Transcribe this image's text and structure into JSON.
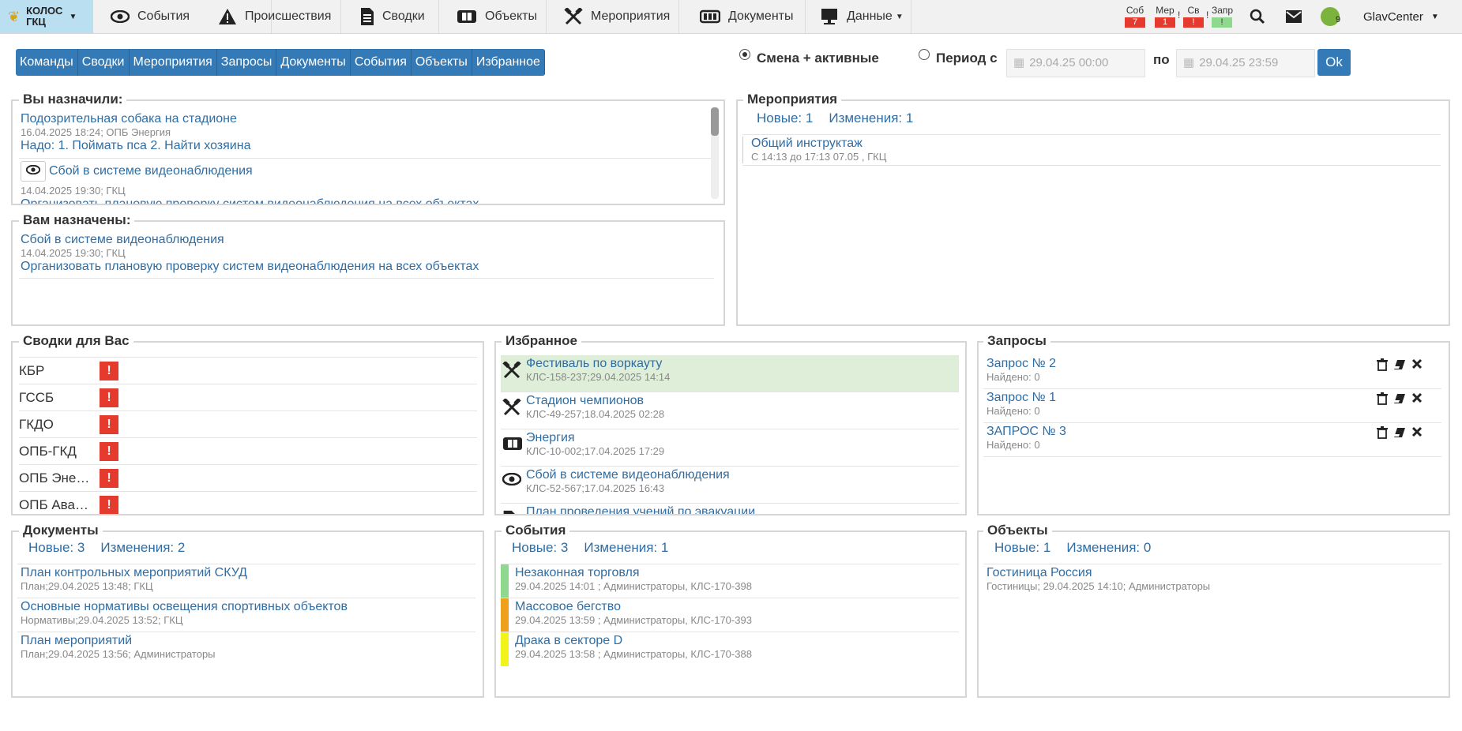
{
  "brand": {
    "title_line1": "КОЛОС",
    "title_line2": "ГКЦ"
  },
  "nav": [
    {
      "label": "События",
      "icon": "eye-icon"
    },
    {
      "label": "Происшествия",
      "icon": "warning-icon"
    },
    {
      "label": "Сводки",
      "icon": "document-icon"
    },
    {
      "label": "Объекты",
      "icon": "stadium-icon"
    },
    {
      "label": "Мероприятия",
      "icon": "crossed-hammers-icon"
    },
    {
      "label": "Документы",
      "icon": "documents-icon"
    },
    {
      "label": "Данные",
      "icon": "monitor-icon"
    }
  ],
  "indicators": [
    {
      "label": "Соб",
      "value": "7",
      "color": "#e53b2f"
    },
    {
      "label": "Мер",
      "value": "1",
      "color": "#e53b2f"
    },
    {
      "label": "Св",
      "value": "!",
      "color": "#e53b2f"
    },
    {
      "label": "Запр",
      "value": "!",
      "color": "#8fd98f"
    }
  ],
  "user": {
    "name": "GlavCenter",
    "badge": "9"
  },
  "tabs": [
    "Команды",
    "Сводки",
    "Мероприятия",
    "Запросы",
    "Документы",
    "События",
    "Объекты",
    "Избранное"
  ],
  "filter": {
    "shift_label": "Смена + активные",
    "period_label": "Период с",
    "to_label": "по",
    "from_value": "29.04.25 00:00",
    "to_value": "29.04.25 23:59",
    "ok_label": "Ok"
  },
  "assigned_by_you": {
    "legend": "Вы назначили:",
    "items": [
      {
        "title": "Подозрительная собака на стадионе",
        "meta": "16.04.2025 18:24; ОПБ Энергия",
        "task": "Надо: 1. Поймать пса 2. Найти хозяина"
      },
      {
        "title": "Сбой в системе видеонаблюдения",
        "meta": "14.04.2025 19:30; ГКЦ",
        "task": "Организовать плановую проверку систем видеонаблюдения на всех объектах"
      }
    ]
  },
  "assigned_to_you": {
    "legend": "Вам назначены:",
    "items": [
      {
        "title": "Сбой в системе видеонаблюдения",
        "meta": "14.04.2025 19:30; ГКЦ",
        "task": "Организовать плановую проверку систем видеонаблюдения на всех объектах"
      }
    ]
  },
  "events_panel": {
    "legend": "Мероприятия",
    "new_label": "Новые: 1",
    "changes_label": "Изменения: 1",
    "items": [
      {
        "title": "Общий инструктаж",
        "meta": "С 14:13 до 17:13 07.05 , ГКЦ"
      }
    ]
  },
  "summaries": {
    "legend": "Сводки для Вас",
    "items": [
      "КБР",
      "ГССБ",
      "ГКДО",
      "ОПБ-ГКД",
      "ОПБ Эне…",
      "ОПБ Ава…"
    ],
    "badge": "!"
  },
  "favorites": {
    "legend": "Избранное",
    "items": [
      {
        "title": "Фестиваль по воркауту",
        "meta": "КЛС-158-237;29.04.2025 14:14",
        "icon": "crossed-hammers-icon",
        "highlight": true
      },
      {
        "title": "Стадион чемпионов",
        "meta": "КЛС-49-257;18.04.2025 02:28",
        "icon": "crossed-hammers-icon"
      },
      {
        "title": "Энергия",
        "meta": "КЛС-10-002;17.04.2025 17:29",
        "icon": "stadium-icon"
      },
      {
        "title": "Сбой в системе видеонаблюдения",
        "meta": "КЛС-52-567;17.04.2025 16:43",
        "icon": "eye-icon"
      },
      {
        "title": "План проведения учений по эвакуации",
        "meta": "",
        "icon": "document-icon"
      }
    ]
  },
  "requests": {
    "legend": "Запросы",
    "items": [
      {
        "title": "Запрос № 2",
        "meta": "Найдено: 0"
      },
      {
        "title": "Запрос № 1",
        "meta": "Найдено: 0"
      },
      {
        "title": "ЗАПРОС № 3",
        "meta": "Найдено: 0"
      }
    ]
  },
  "documents": {
    "legend": "Документы",
    "new_label": "Новые: 3",
    "changes_label": "Изменения: 2",
    "items": [
      {
        "title": "План контрольных мероприятий СКУД",
        "meta": "План;29.04.2025 13:48; ГКЦ"
      },
      {
        "title": "Основные нормативы освещения спортивных объектов",
        "meta": "Нормативы;29.04.2025 13:52; ГКЦ"
      },
      {
        "title": "План мероприятий",
        "meta": "План;29.04.2025 13:56; Администраторы"
      }
    ]
  },
  "events": {
    "legend": "События",
    "new_label": "Новые: 3",
    "changes_label": "Изменения: 1",
    "items": [
      {
        "title": "Незаконная торговля",
        "meta": "29.04.2025 14:01 ; Администраторы, КЛС-170-398",
        "color": "#8fd98f"
      },
      {
        "title": "Массовое бегство",
        "meta": "29.04.2025 13:59 ; Администраторы, КЛС-170-393",
        "color": "#f0a11c"
      },
      {
        "title": "Драка в секторе D",
        "meta": "29.04.2025 13:58 ; Администраторы, КЛС-170-388",
        "color": "#f3f31c"
      }
    ]
  },
  "objects": {
    "legend": "Объекты",
    "new_label": "Новые: 1",
    "changes_label": "Изменения: 0",
    "items": [
      {
        "title": "Гостиница Россия",
        "meta": "Гостиницы; 29.04.2025 14:10; Администраторы"
      }
    ]
  }
}
